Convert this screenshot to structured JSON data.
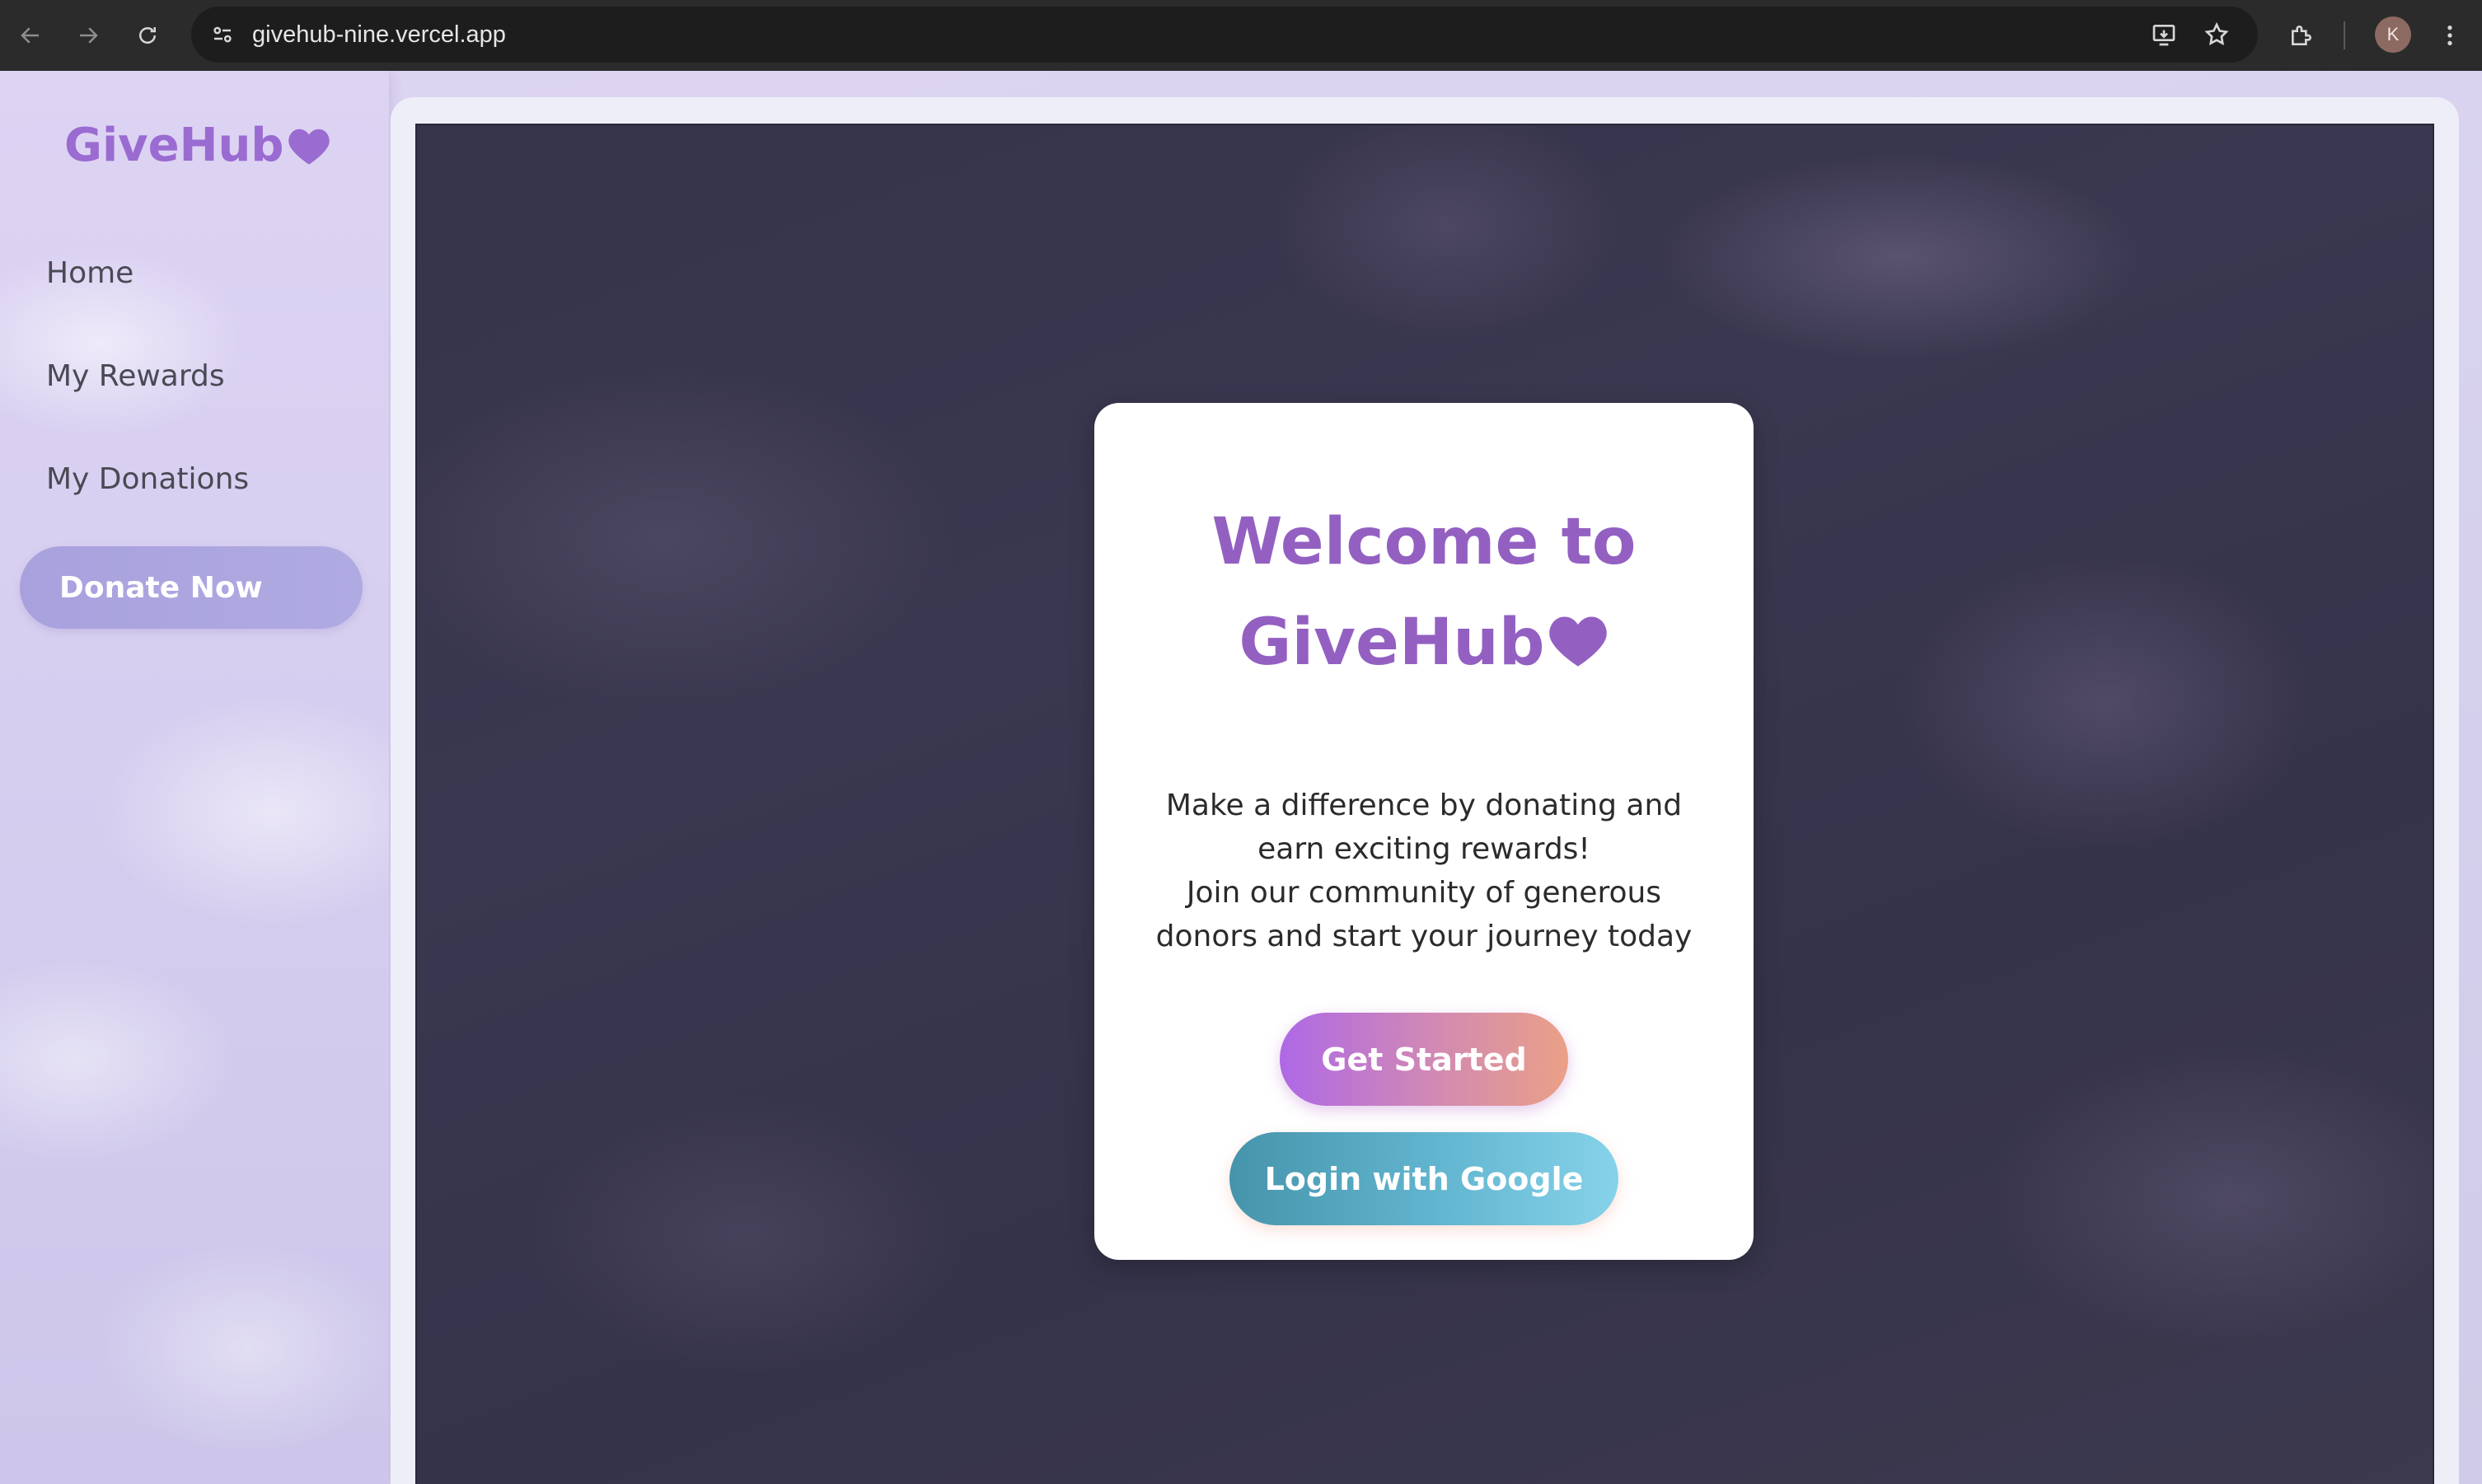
{
  "browser": {
    "url": "givehub-nine.vercel.app",
    "profile_initial": "K",
    "icons": {
      "back": "arrow-left-icon",
      "forward": "arrow-right-icon",
      "reload": "reload-icon",
      "site_info": "tune-icon",
      "install": "install-app-icon",
      "bookmark": "star-icon",
      "extensions": "puzzle-icon",
      "menu": "kebab-menu-icon"
    }
  },
  "sidebar": {
    "logo_text": "GiveHub",
    "logo_icon": "heart-icon",
    "items": [
      {
        "label": "Home"
      },
      {
        "label": "My Rewards"
      },
      {
        "label": "My Donations"
      }
    ],
    "cta_label": "Donate Now"
  },
  "welcome": {
    "title_line1": "Welcome to",
    "title_line2": "GiveHub",
    "description_lines": [
      "Make a difference by donating and",
      "earn exciting rewards!",
      "Join our community of generous",
      "donors and start your journey today"
    ],
    "primary_button": "Get Started",
    "google_button": "Login with Google"
  },
  "colors": {
    "brand_purple": "#9360c2",
    "sidebar_cta": "#a8a1dd",
    "get_started_gradient": [
      "#ae68e6",
      "#eaa086"
    ],
    "google_gradient": [
      "#4694ac",
      "#86d2ea"
    ],
    "hero_background": "#36344a"
  }
}
